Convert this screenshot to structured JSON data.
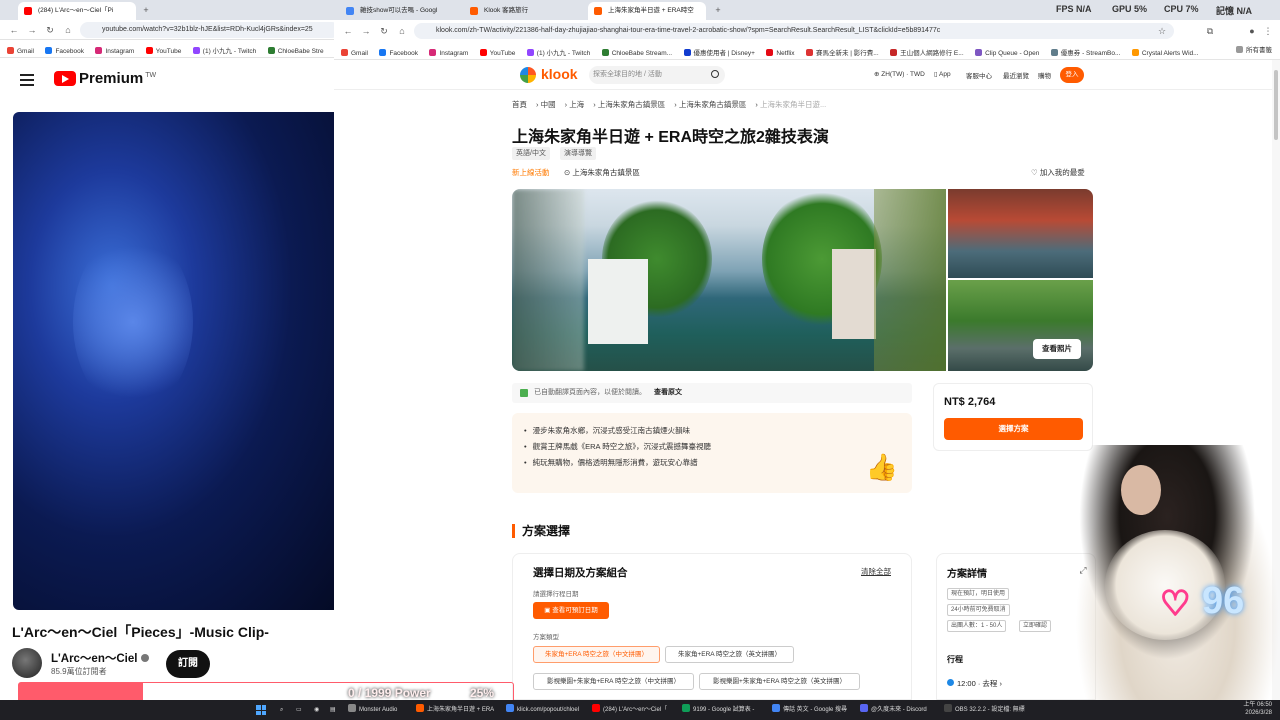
{
  "youtube_window": {
    "tab_label": "(284) L'Arc～en～Ciel「Pi",
    "url": "youtube.com/watch?v=32b1blz-hJE&list=RDh-Kucl4jGRs&index=25",
    "bookmarks": [
      "Gmail",
      "Facebook",
      "Instagram",
      "YouTube",
      "(1) 小九九 - Twitch",
      "ChloeBabe Stre"
    ],
    "brand": "Premium",
    "region": "TW",
    "video_title": "L'Arc～en～Ciel「Pieces」-Music Clip-",
    "channel_name": "L'Arc～en～Ciel",
    "subscribers": "85.9萬位訂閱者",
    "subscribe_label": "訂閱"
  },
  "browser": {
    "tabs": [
      {
        "label": "雜技show可以去嗎 - Googl"
      },
      {
        "label": "Klook 客路旅行"
      },
      {
        "label": "上海朱家角半日遊 + ERA時空"
      }
    ],
    "url": "klook.com/zh-TW/activity/221386-half-day-zhujiajiao-shanghai-tour-era-time-travel-2-acrobatic-show/?spm=SearchResult.SearchResult_LIST&clickId=e5b891477c",
    "bookmarks": [
      "Gmail",
      "Facebook",
      "Instagram",
      "YouTube",
      "(1) 小九九 - Twitch",
      "ChloeBabe Stream...",
      "優惠使用者 | Disney+",
      "Netflix",
      "賽馬全新未 | 影行費...",
      "王山個人網路修行 E...",
      "Clip Queue - Open",
      "優惠券 - StreamBo...",
      "Crystal Alerts Wid...",
      "所有書籤"
    ]
  },
  "klook": {
    "logo_text": "klook",
    "search_placeholder": "探索全球目的地 / 活動",
    "nav": {
      "lang": "ZH(TW) · TWD",
      "app": "App",
      "help": "客服中心",
      "recent": "最近瀏覽",
      "cart": "購物",
      "login": "登入"
    },
    "breadcrumbs": [
      "首頁",
      "中國",
      "上海",
      "上海朱家角古鎮景區",
      "上海朱家角古鎮景區",
      "上海朱家角半日遊..."
    ],
    "title": "上海朱家角半日遊 + ERA時空之旅2雜技表演",
    "chips": [
      "英語/中文",
      "演導導覽"
    ],
    "new_activity": "新上線活動",
    "location": "上海朱家角古鎮景區",
    "wishlist": "加入我的最愛",
    "view_photos": "查看照片",
    "translated_note": "已自動翻譯頁面內容，以便於閱讀。",
    "view_original": "查看原文",
    "highlights": [
      "漫步朱家角水鄉，沉浸式感受江南古鎮煙火韻味",
      "觀賞王牌馬戲《ERA 時空之旅》，沉浸式震撼舞臺視聽",
      "純玩無購物，價格透明無隱形消費，遊玩安心靠譜"
    ],
    "price": "NT$ 2,764",
    "select_plan": "選擇方案",
    "section_title": "方案選擇",
    "options_box": {
      "title": "選擇日期及方案組合",
      "clear": "清除全部",
      "date_label": "請選擇行程日期",
      "date_button": "查看可預訂日期",
      "type_label": "方案類型",
      "options": [
        "朱家角+ERA 時空之旅（中文拼團）",
        "朱家角+ERA 時空之旅（英文拼團）",
        "影視樂園+朱家角+ERA 時空之旅（中文拼團）",
        "影視樂園+朱家角+ERA 時空之旅（英文拼團）"
      ]
    },
    "details_box": {
      "title": "方案詳情",
      "tags": [
        "現在預訂，明日使用",
        "24小時前可免費取消",
        "出團人數：1 - 50人",
        "立即確認"
      ],
      "itinerary_label": "行程",
      "itinerary_item": "12:00 · 去程"
    }
  },
  "overlay": {
    "fps": "FPS N/A",
    "gpu": "GPU 5%",
    "cpu": "CPU 7%",
    "mem": "記憶 N/A",
    "heart_count": "96",
    "power_text": "0 / 1999 Power",
    "power_percent": "25%",
    "power_fill": 0.25
  },
  "taskbar": {
    "items": [
      "Monster Audio",
      "上海朱家角半日遊 + ERA",
      "klick.com/popout/chloel",
      "(284) L'Arc～en～Ciel「",
      "9199 - Google 試算表 -",
      "傳話 英文 - Google 搜尋",
      "@久度未來 - Discord",
      "OBS 32.2.2 - 設定檔: 無標"
    ],
    "time": "上午 06:50",
    "date": "2026/3/28"
  }
}
